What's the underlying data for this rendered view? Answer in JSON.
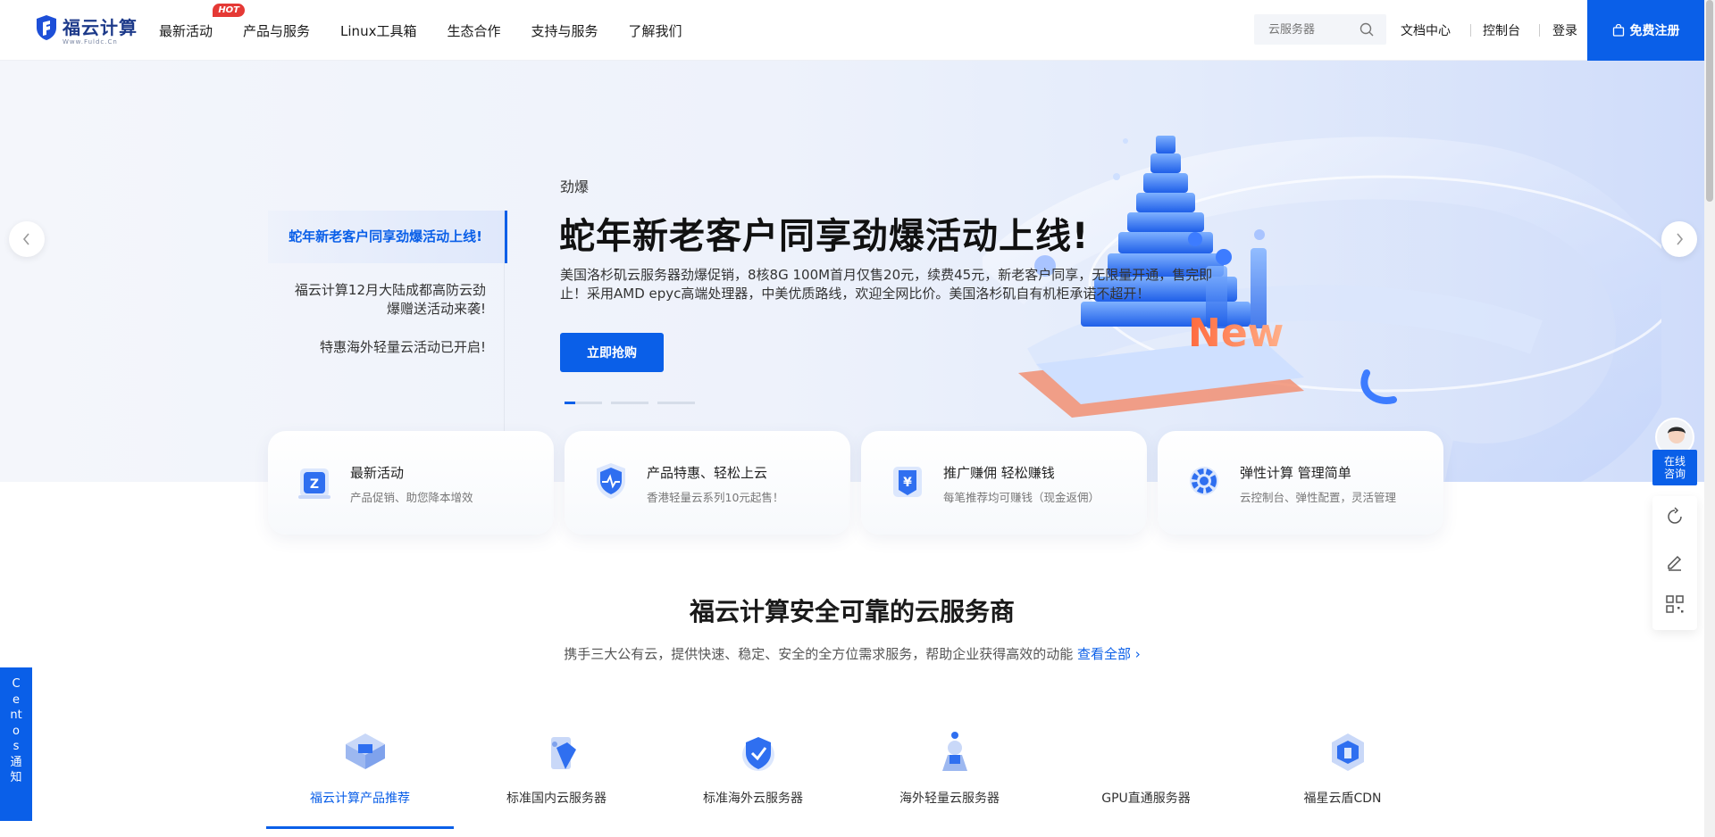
{
  "brand": {
    "name": "福云计算",
    "sub": "Www.Fuldc.Cn"
  },
  "nav": [
    {
      "label": "最新活动",
      "badge": "HOT"
    },
    {
      "label": "产品与服务"
    },
    {
      "label": "Linux工具箱"
    },
    {
      "label": "生态合作"
    },
    {
      "label": "支持与服务"
    },
    {
      "label": "了解我们"
    }
  ],
  "search": {
    "placeholder": "云服务器"
  },
  "header_links": {
    "docs": "文档中心",
    "console": "控制台",
    "login": "登录",
    "register": "免费注册"
  },
  "hero": {
    "side_items": [
      "蛇年新老客户同享劲爆活动上线!",
      "福云计算12月大陆成都高防云劲爆赠送活动来袭!",
      "特惠海外轻量云活动已开启!"
    ],
    "tag": "劲爆",
    "title": "蛇年新老客户同享劲爆活动上线!",
    "description": "美国洛杉矶云服务器劲爆促销，8核8G 100M首月仅售20元，续费45元，新老客户同享，无限量开通，售完即止！采用AMD epyc高端处理器，中美优质路线，欢迎全网比价。美国洛杉矶自有机柜承诺不超开！",
    "button": "立即抢购",
    "new_badge": "New"
  },
  "features": [
    {
      "title": "最新活动",
      "sub": "产品促销、助您降本增效",
      "icon": "gift-box-icon"
    },
    {
      "title": "产品特惠、轻松上云",
      "sub": "香港轻量云系列10元起售！",
      "icon": "shield-pulse-icon"
    },
    {
      "title": "推广赚佣 轻松赚钱",
      "sub": "每笔推荐均可赚钱（现金返佣）",
      "icon": "yen-wallet-icon"
    },
    {
      "title": "弹性计算 管理简单",
      "sub": "云控制台、弹性配置，灵活管理",
      "icon": "gear-cloud-icon"
    }
  ],
  "section": {
    "title": "福云计算安全可靠的云服务商",
    "subtitle": "携手三大公有云，提供快速、稳定、安全的全方位需求服务，帮助企业获得高效的动能",
    "view_all": "查看全部"
  },
  "product_tabs": [
    {
      "label": "福云计算产品推荐",
      "active": true
    },
    {
      "label": "标准国内云服务器"
    },
    {
      "label": "标准海外云服务器"
    },
    {
      "label": "海外轻量云服务器"
    },
    {
      "label": "GPU直通服务器"
    },
    {
      "label": "福星云盾CDN"
    }
  ],
  "float": {
    "consult": "在线\n咨询"
  },
  "centos_tab": "Centos通知",
  "colors": {
    "primary": "#0a5fe8",
    "hot": "#e53935",
    "new": "#ff7a3d"
  }
}
